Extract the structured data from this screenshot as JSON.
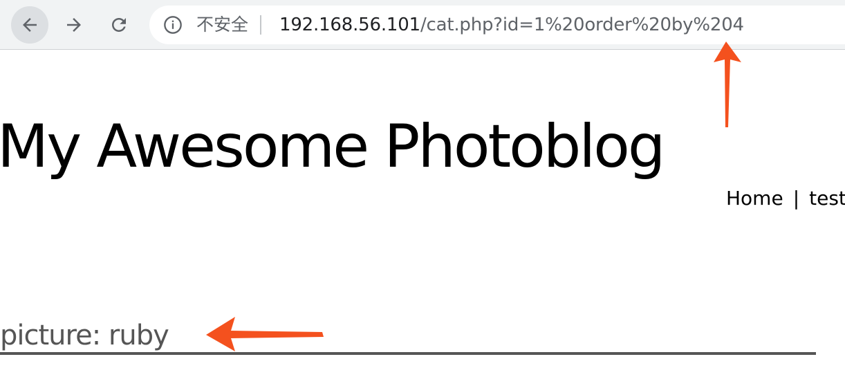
{
  "browser": {
    "security_label": "不安全",
    "url_host": "192.168.56.101",
    "url_path": "/cat.php?id=1%20order%20by%204",
    "buttons": {
      "back_icon": "arrow-left-icon",
      "forward_icon": "arrow-right-icon",
      "reload_icon": "reload-icon"
    }
  },
  "site": {
    "title": "My Awesome Photoblog",
    "nav": [
      {
        "label": "Home"
      },
      {
        "label": "test"
      }
    ],
    "nav_separator": "|"
  },
  "main": {
    "picture_heading": "picture: ruby"
  },
  "annotations": {
    "arrow_color": "#f4511e"
  }
}
